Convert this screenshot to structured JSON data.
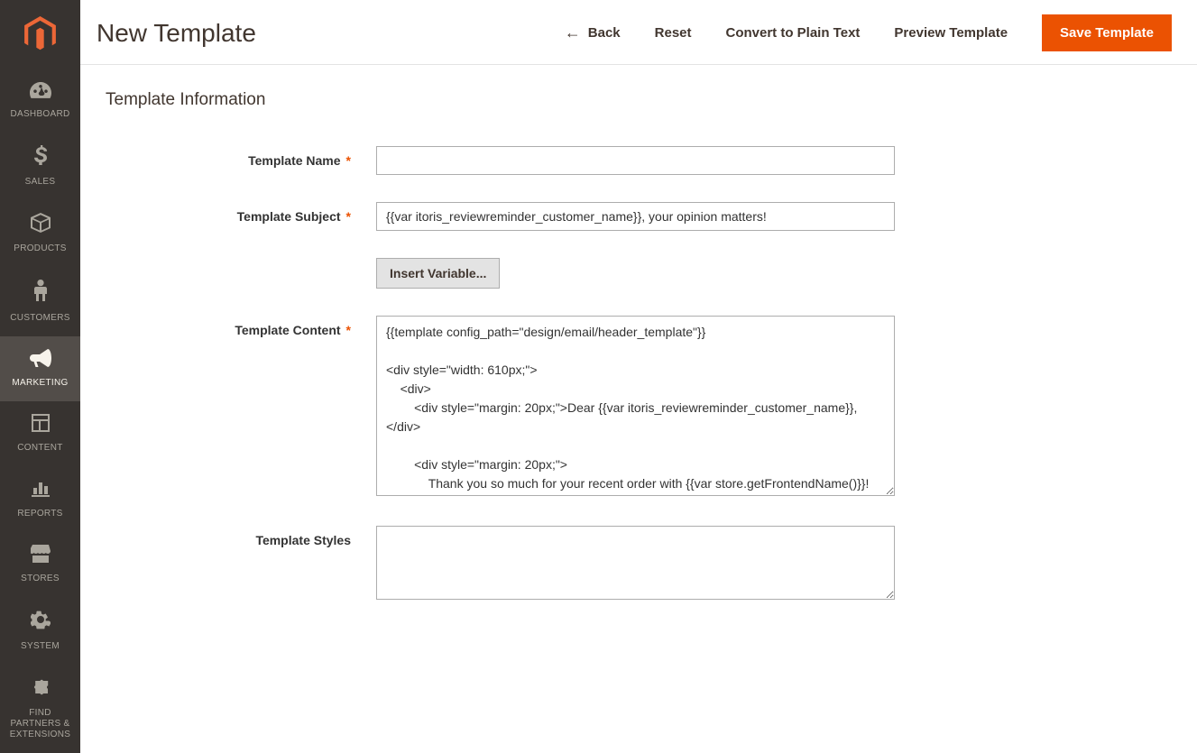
{
  "sidebar": {
    "items": [
      {
        "label": "DASHBOARD"
      },
      {
        "label": "SALES"
      },
      {
        "label": "PRODUCTS"
      },
      {
        "label": "CUSTOMERS"
      },
      {
        "label": "MARKETING"
      },
      {
        "label": "CONTENT"
      },
      {
        "label": "REPORTS"
      },
      {
        "label": "STORES"
      },
      {
        "label": "SYSTEM"
      },
      {
        "label": "FIND PARTNERS & EXTENSIONS"
      }
    ]
  },
  "header": {
    "title": "New Template",
    "actions": {
      "back": "Back",
      "reset": "Reset",
      "convert": "Convert to Plain Text",
      "preview": "Preview Template",
      "save": "Save Template"
    }
  },
  "form": {
    "section_title": "Template Information",
    "name_label": "Template Name",
    "name_value": "",
    "subject_label": "Template Subject",
    "subject_value": "{{var itoris_reviewreminder_customer_name}}, your opinion matters!",
    "insert_variable": "Insert Variable...",
    "content_label": "Template Content",
    "content_value": "{{template config_path=\"design/email/header_template\"}}\n\n<div style=\"width: 610px;\">\n    <div>\n        <div style=\"margin: 20px;\">Dear {{var itoris_reviewreminder_customer_name}},</div>\n\n        <div style=\"margin: 20px;\">\n            Thank you so much for your recent order with {{var store.getFrontendName()}}!\n        </div>",
    "styles_label": "Template Styles",
    "styles_value": ""
  }
}
